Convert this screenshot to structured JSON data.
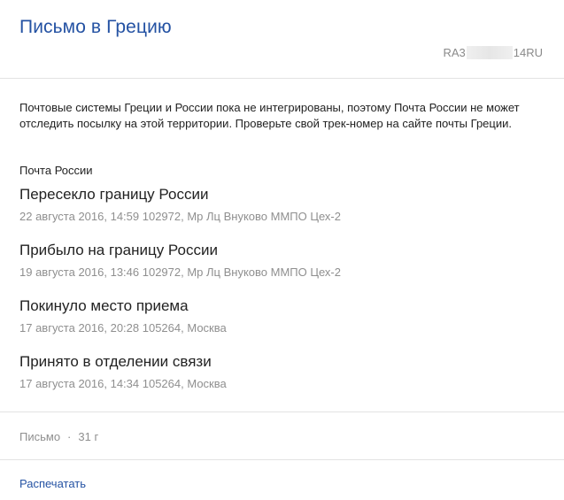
{
  "header": {
    "title": "Письмо в Грецию",
    "track_prefix": "RA3",
    "track_suffix": "14RU"
  },
  "notice": "Почтовые системы Греции и России пока не интегрированы, поэтому Почта России не может отследить посылку на этой территории. Проверьте свой трек-номер на сайте почты Греции.",
  "carrier": "Почта России",
  "events": [
    {
      "status": "Пересекло границу России",
      "details": "22 августа 2016, 14:59 102972, Мр Лц Внуково ММПО Цех-2"
    },
    {
      "status": "Прибыло на границу России",
      "details": "19 августа 2016, 13:46 102972, Мр Лц Внуково ММПО Цех-2"
    },
    {
      "status": "Покинуло место приема",
      "details": "17 августа 2016, 20:28 105264, Москва"
    },
    {
      "status": "Принято в отделении связи",
      "details": "17 августа 2016, 14:34 105264, Москва"
    }
  ],
  "summary": {
    "type": "Письмо",
    "separator": "·",
    "weight": "31 г"
  },
  "actions": {
    "print_label": "Распечатать"
  },
  "colors": {
    "accent": "#2452a3",
    "muted_text": "#8f8f8f",
    "divider": "#e3e3e3"
  }
}
